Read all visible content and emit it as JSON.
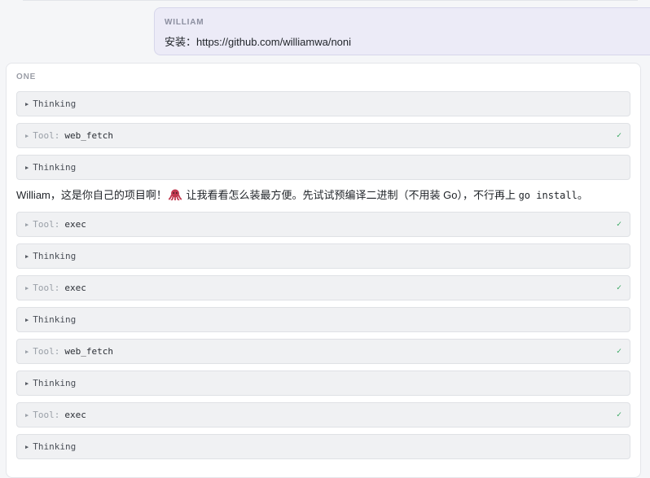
{
  "user_message": {
    "author": "WILLIAM",
    "text": "安装：https://github.com/williamwa/noni"
  },
  "assistant_message": {
    "author": "ONE",
    "reply": {
      "before_emoji": "William，这是你自己的项目啊！",
      "emoji_icon": "octopus-icon",
      "after_emoji": " 让我看看怎么装最方便。先试试预编译二进制（不用装 Go），不行再上 ",
      "code": "go install",
      "after_code": "。"
    },
    "blocks": [
      {
        "kind": "thinking",
        "label": "Thinking"
      },
      {
        "kind": "tool",
        "prefix": "Tool:",
        "name": "web_fetch",
        "status": "✓"
      },
      {
        "kind": "thinking",
        "label": "Thinking"
      },
      {
        "kind": "tool",
        "prefix": "Tool:",
        "name": "exec",
        "status": "✓"
      },
      {
        "kind": "thinking",
        "label": "Thinking"
      },
      {
        "kind": "tool",
        "prefix": "Tool:",
        "name": "exec",
        "status": "✓"
      },
      {
        "kind": "thinking",
        "label": "Thinking"
      },
      {
        "kind": "tool",
        "prefix": "Tool:",
        "name": "web_fetch",
        "status": "✓"
      },
      {
        "kind": "thinking",
        "label": "Thinking"
      },
      {
        "kind": "tool",
        "prefix": "Tool:",
        "name": "exec",
        "status": "✓"
      },
      {
        "kind": "thinking",
        "label": "Thinking"
      }
    ],
    "expand_glyph": "▶"
  },
  "colors": {
    "user_bubble": "#ecebf7",
    "check": "#2fa45a"
  }
}
